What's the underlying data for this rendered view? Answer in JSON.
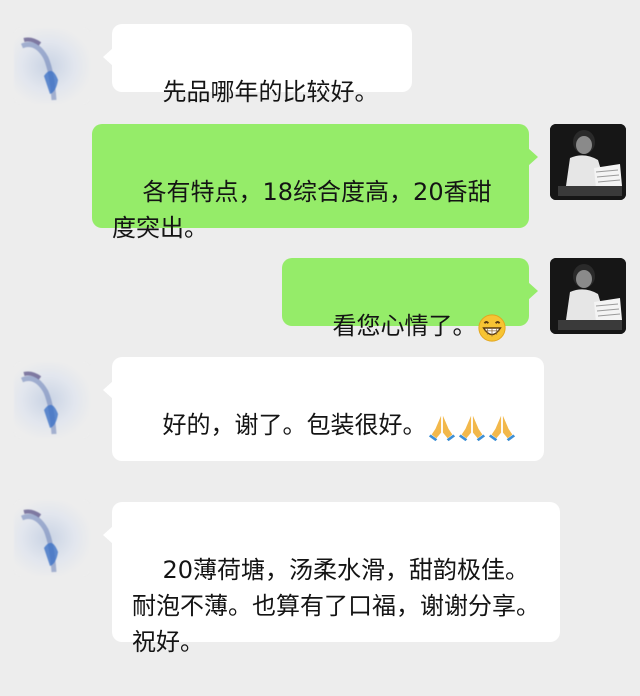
{
  "messages": [
    {
      "side": "in",
      "text": "先品哪年的比较好。"
    },
    {
      "side": "out",
      "text": "各有特点，18综合度高，20香甜度突出。"
    },
    {
      "side": "out",
      "text": "看您心情了。",
      "emoji": "grinning-face-icon"
    },
    {
      "side": "in",
      "text": "好的，谢了。包装很好。",
      "emoji": "folded-hands-icon ×3"
    },
    {
      "side": "in",
      "text": "20薄荷塘，汤柔水滑，甜韵极佳。耐泡不薄。也算有了口福，谢谢分享。祝好。"
    }
  ],
  "colors": {
    "background": "#ededed",
    "incoming_bubble": "#ffffff",
    "outgoing_bubble": "#95ec69",
    "text": "#141414"
  }
}
